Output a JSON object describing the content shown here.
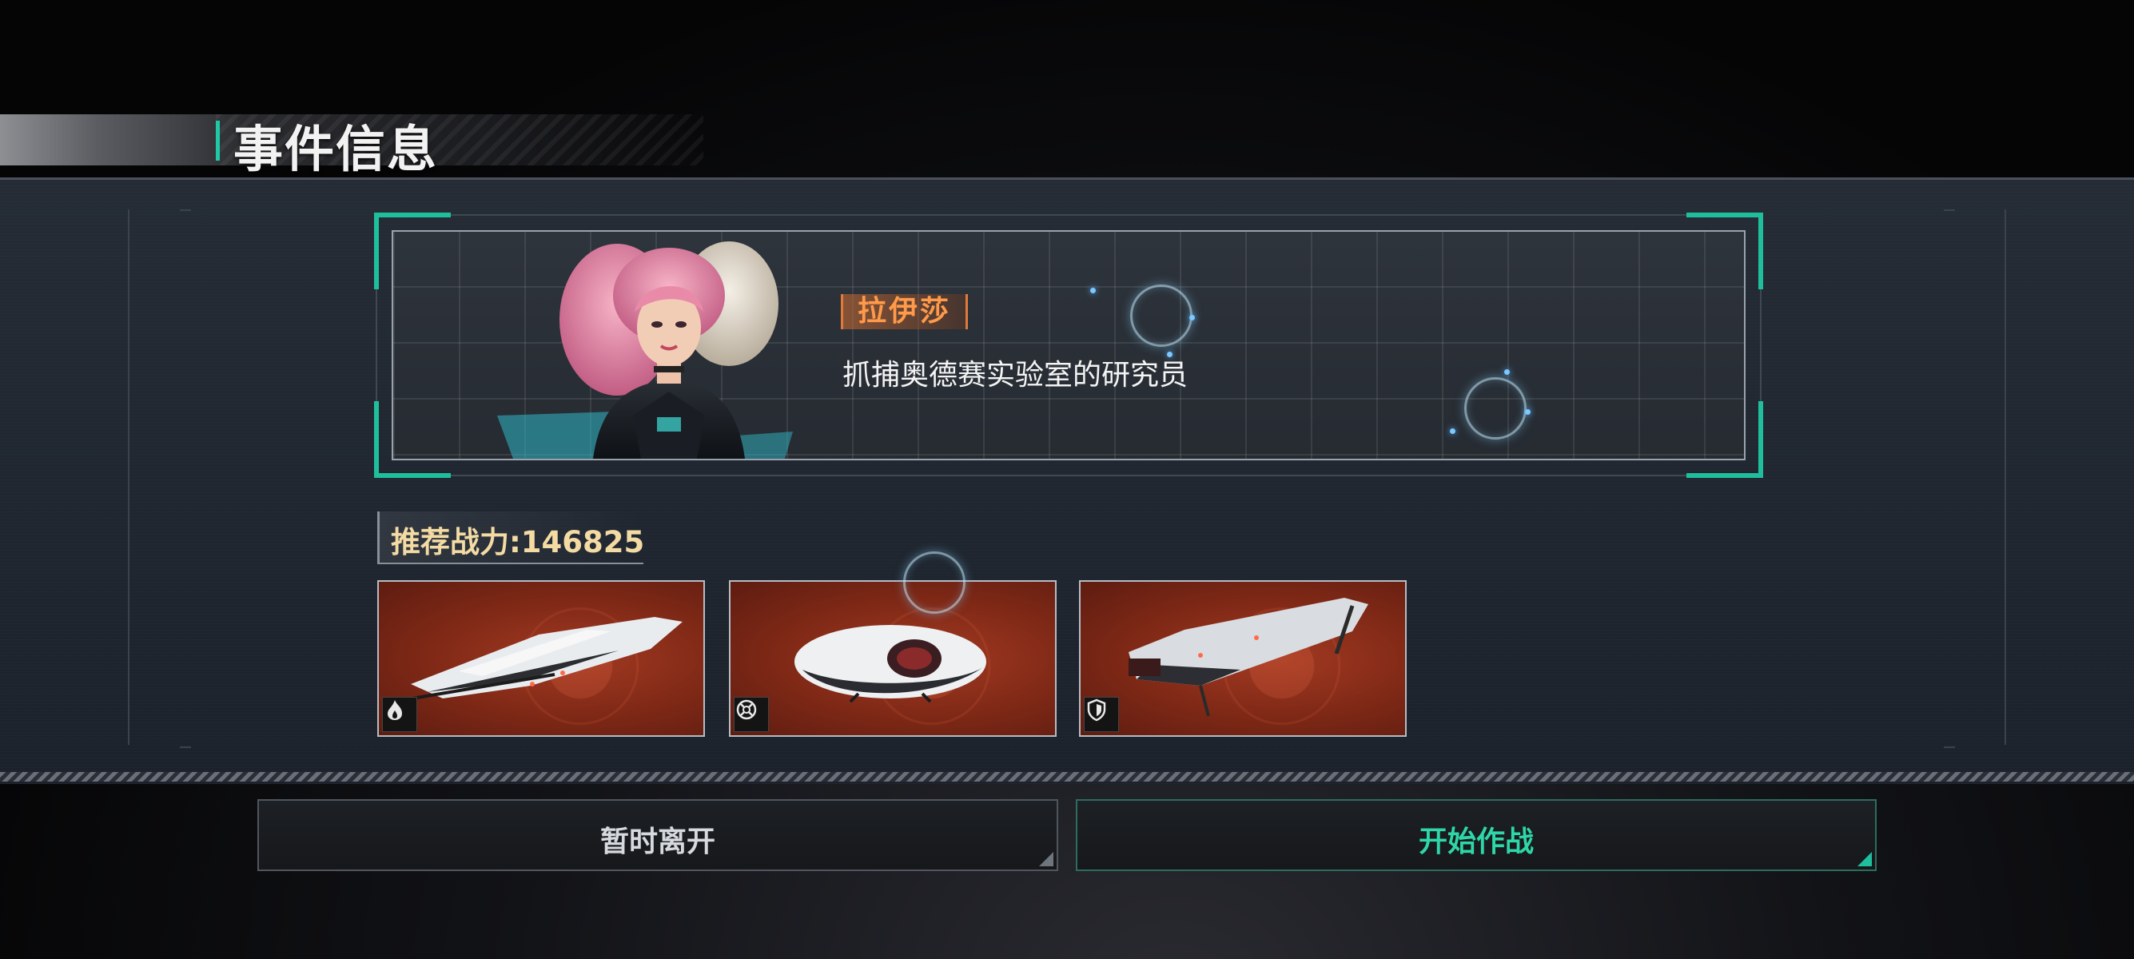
{
  "header": {
    "title": "事件信息"
  },
  "event": {
    "character_name": "拉伊莎",
    "character_description": "抓捕奥德赛实验室的研究员"
  },
  "recommended_power": {
    "label": "推荐战力:146825"
  },
  "ships": [
    {
      "type_icon": "flame-icon"
    },
    {
      "type_icon": "crosshair-icon"
    },
    {
      "type_icon": "shield-icon"
    }
  ],
  "buttons": {
    "leave_label": "暂时离开",
    "start_label": "开始作战"
  },
  "colors": {
    "accent_teal": "#1fc9a6",
    "name_orange": "#ff9a4a",
    "power_gold": "#f3dba3",
    "ship_card_red": "#7e2816"
  }
}
